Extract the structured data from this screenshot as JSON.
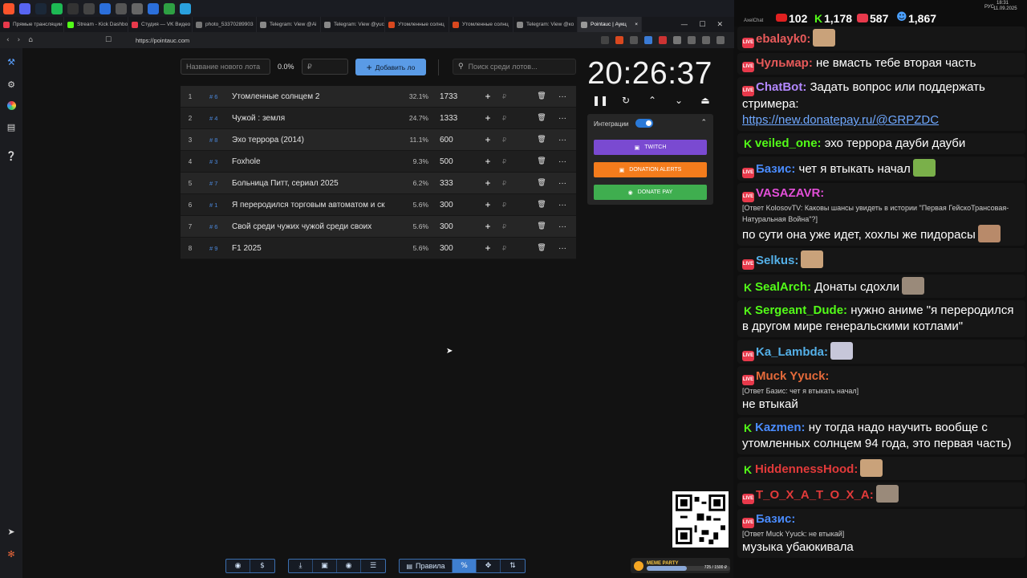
{
  "taskbar": {
    "icons": [
      "brave-icon",
      "discord-icon",
      "steam-icon",
      "spotify-icon",
      "obs-icon",
      "x-icon",
      "tb7-icon",
      "tb8-icon",
      "tb9-icon",
      "tb10-icon",
      "tb11-icon",
      "telegram-icon"
    ]
  },
  "tabs": [
    {
      "label": "Прямые трансляции",
      "color": "#e8394b"
    },
    {
      "label": "Stream - Kick Dashbo",
      "color": "#53fc18"
    },
    {
      "label": "Студия — VK Видео",
      "color": "#e8394b"
    },
    {
      "label": "photo_53370289903",
      "color": "#777777"
    },
    {
      "label": "Telegram: View @Ai",
      "color": "#888888"
    },
    {
      "label": "Telegram: View @yuc",
      "color": "#888888"
    },
    {
      "label": "Утомленные солнц",
      "color": "#d9481f"
    },
    {
      "label": "Утомленные солнц",
      "color": "#d9481f"
    },
    {
      "label": "Telegram: View @ко",
      "color": "#888888"
    },
    {
      "label": "Pointauc | Аукц",
      "color": "#999999",
      "active": true
    }
  ],
  "window_controls": {
    "minimize": "—",
    "maximize": "☐",
    "close": "✕"
  },
  "address": {
    "url": "https://pointauc.com"
  },
  "auction": {
    "new_lot_placeholder": "Название нового лота",
    "percent": "0.0%",
    "amount_placeholder": "₽",
    "add_label": "Добавить ло",
    "search_placeholder": "Поиск среди лотов...",
    "timer": "20:26:37",
    "lots": [
      {
        "n": "1",
        "id": "# 6",
        "name": "Утомленные солнцем 2",
        "pct": "32.1%",
        "amount": "1733"
      },
      {
        "n": "2",
        "id": "# 4",
        "name": "Чужой : земля",
        "pct": "24.7%",
        "amount": "1333"
      },
      {
        "n": "3",
        "id": "# 8",
        "name": "Эхо террора (2014)",
        "pct": "11.1%",
        "amount": "600"
      },
      {
        "n": "4",
        "id": "# 3",
        "name": "Foxhole",
        "pct": "9.3%",
        "amount": "500"
      },
      {
        "n": "5",
        "id": "# 7",
        "name": "Больница Питт, сериал 2025",
        "pct": "6.2%",
        "amount": "333"
      },
      {
        "n": "6",
        "id": "# 1",
        "name": "Я переродился торговым автоматом и ск",
        "pct": "5.6%",
        "amount": "300"
      },
      {
        "n": "7",
        "id": "# 6",
        "name": "Свой среди чужих чужой среди своих",
        "pct": "5.6%",
        "amount": "300"
      },
      {
        "n": "8",
        "id": "# 9",
        "name": "F1 2025",
        "pct": "5.6%",
        "amount": "300"
      }
    ],
    "integrations": {
      "title": "Интеграции",
      "buttons": [
        {
          "label": "TWITCH",
          "color": "#7a4ad1"
        },
        {
          "label": "DONATION ALERTS",
          "color": "#f47c1c"
        },
        {
          "label": "DONATE PAY",
          "color": "#3fae4f"
        }
      ]
    },
    "bottom": {
      "rules_label": "Правила",
      "percent_label": "%"
    }
  },
  "meme_party": {
    "title": "MEME PARTY",
    "count": "725 / 1500 ₽"
  },
  "chat_header": {
    "title": "AxelChat",
    "stats": [
      "102",
      "1,178",
      "587",
      "1,867"
    ],
    "time": "18:31",
    "date": "11.09.2025",
    "lang": "РУС"
  },
  "chat": [
    {
      "source": "live",
      "user": "ebalayk0:",
      "color": "#e85a5a",
      "text": "",
      "emote": true
    },
    {
      "source": "live",
      "user": "Чульмар:",
      "color": "#e85a5a",
      "text": "не вмасть тебе вторая часть"
    },
    {
      "source": "live",
      "user": "ChatBot:",
      "color": "#b388ff",
      "text": "Задать вопрос или поддержать стримера:",
      "link": "https://new.donatepay.ru/@GRPZDC"
    },
    {
      "source": "kick",
      "user": "veiled_one:",
      "color": "#53fc18",
      "text": "эхо террора дауби дауби"
    },
    {
      "source": "live",
      "user": "Базис:",
      "color": "#4a8cff",
      "text": "чет я втыкать начал",
      "emote": true
    },
    {
      "source": "live",
      "user": "VASAZAVR:",
      "color": "#e24fd8",
      "reply": "[Ответ KolosovTV: Каковы шансы увидеть в истории \"Первая ГейскоТрансовая-Натуральная Война\"?]",
      "text": "по сути она уже идет, хохлы же пидорасы",
      "emote": true
    },
    {
      "source": "live",
      "user": "Selkus:",
      "color": "#54b0e8",
      "text": "",
      "emote": true
    },
    {
      "source": "kick",
      "user": "SealArch:",
      "color": "#53fc18",
      "text": "Донаты сдохли",
      "emote": true
    },
    {
      "source": "kick",
      "user": "Sergeant_Dude:",
      "color": "#53fc18",
      "text": "нужно аниме \"я переродился в другом мире генеральскими котлами\""
    },
    {
      "source": "live",
      "user": "Ka_Lambda:",
      "color": "#54b0e8",
      "text": "",
      "emote": true
    },
    {
      "source": "live",
      "user": "Muck Yyuck:",
      "color": "#e56a3a",
      "reply": "[Ответ Базис: чет я втыкать начал]",
      "text": "не втыкай"
    },
    {
      "source": "kick",
      "user": "Kazmen:",
      "color": "#4a8cff",
      "text": "ну тогда надо научить вообще с утомленных солнцем 94 года, это первая часть)"
    },
    {
      "source": "kick",
      "user": "HiddennessHood:",
      "color": "#e23a3a",
      "text": "",
      "emote": true
    },
    {
      "source": "live",
      "user": "T_O_X_A_T_O_X_A:",
      "color": "#e23a3a",
      "text": "",
      "emote": true
    },
    {
      "source": "live",
      "user": "Базис:",
      "color": "#4a8cff",
      "reply": "[Ответ Muck Yyuck: не втыкай]",
      "text": "музыка убаюкивала"
    }
  ]
}
